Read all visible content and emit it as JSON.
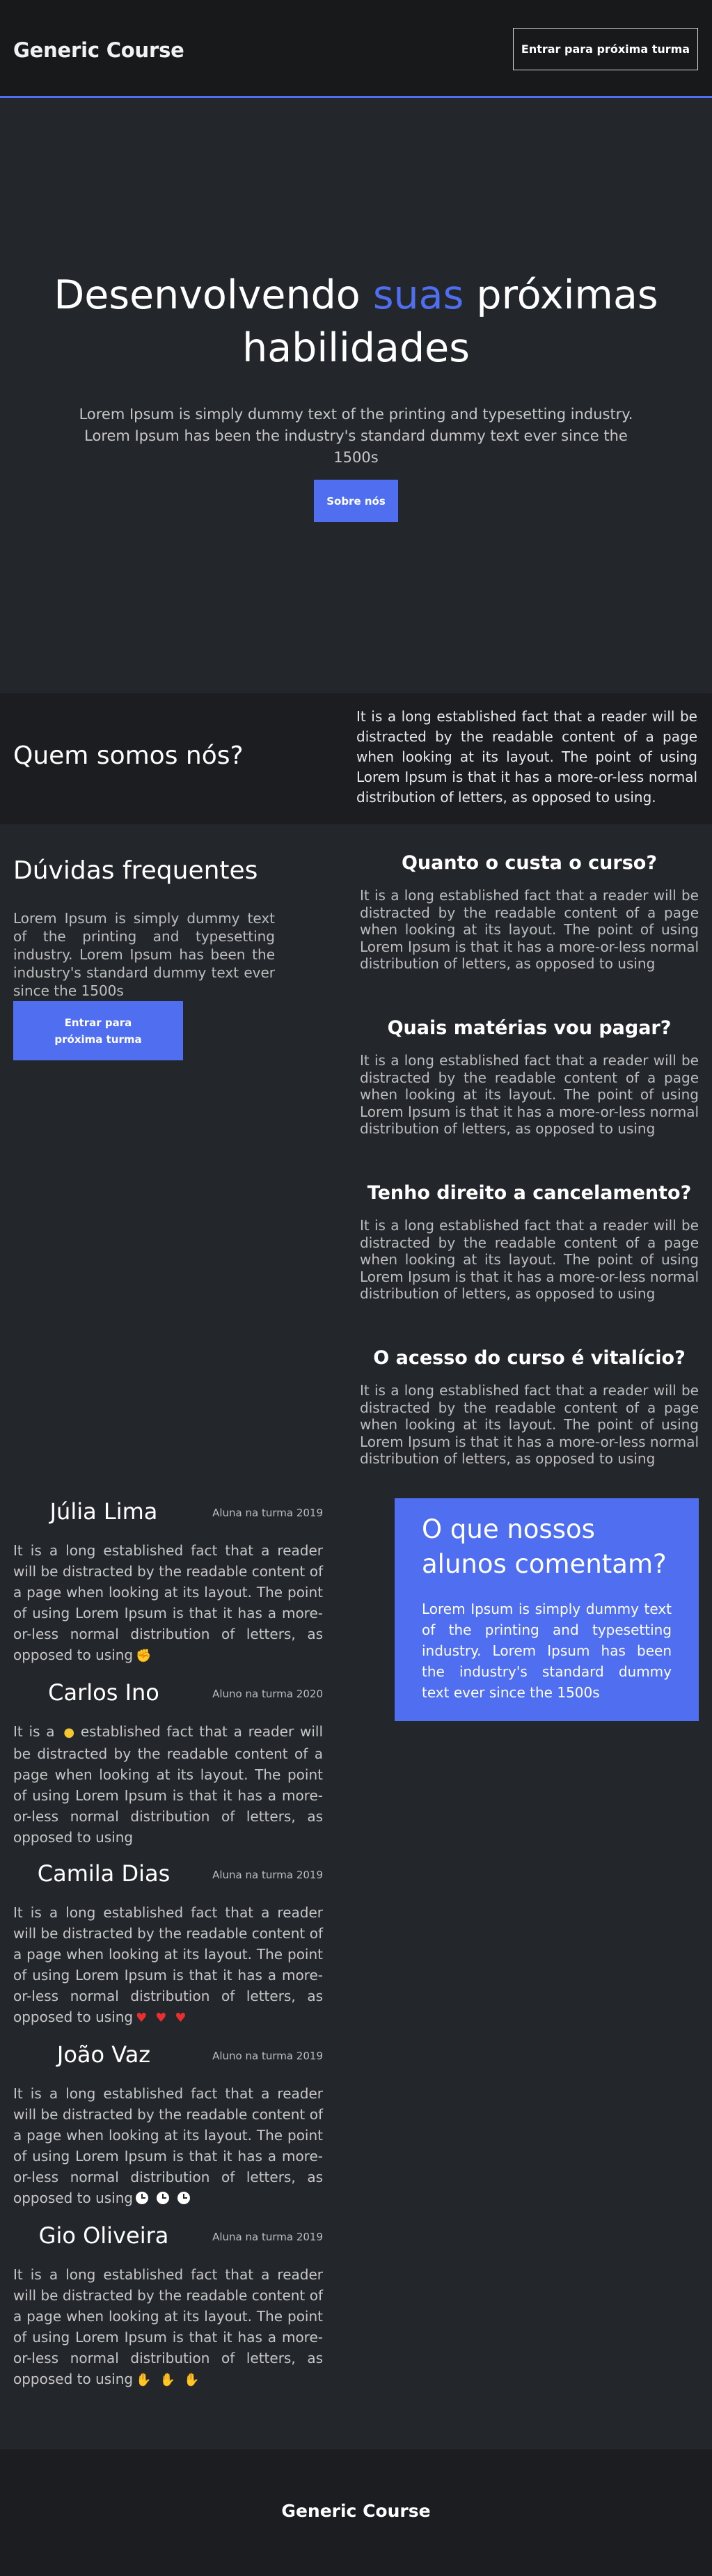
{
  "header": {
    "brand": "Generic Course",
    "cta_label": "Entrar para próxima turma"
  },
  "hero": {
    "title_before": "Desenvolvendo ",
    "title_accent": "suas",
    "title_after": " próximas habilidades",
    "subtitle": "Lorem Ipsum is simply dummy text of the printing and typesetting industry. Lorem Ipsum has been the industry's standard dummy text ever since the 1500s",
    "button_label": "Sobre nós"
  },
  "about": {
    "title": "Quem somos nós?",
    "text": "It is a long established fact that a reader will be distracted by the readable content of a page when looking at its layout. The point of using Lorem Ipsum is that it has a more-or-less normal distribution of letters, as opposed to using."
  },
  "faq": {
    "title": "Dúvidas frequentes",
    "lead": "Lorem Ipsum is simply dummy text of the printing and typesetting industry. Lorem Ipsum has been the industry's standard dummy text ever since the 1500s",
    "button_label": "Entrar para próxima turma",
    "items": [
      {
        "question": "Quanto o custa o curso?",
        "answer": "It is a long established fact that a reader will be distracted by the readable content of a page when looking at its layout. The point of using Lorem Ipsum is that it has a more-or-less normal distribution of letters, as opposed to using"
      },
      {
        "question": "Quais matérias vou pagar?",
        "answer": "It is a long established fact that a reader will be distracted by the readable content of a page when looking at its layout. The point of using Lorem Ipsum is that it has a more-or-less normal distribution of letters, as opposed to using"
      },
      {
        "question": "Tenho direito a cancelamento?",
        "answer": "It is a long established fact that a reader will be distracted by the readable content of a page when looking at its layout. The point of using Lorem Ipsum is that it has a more-or-less normal distribution of letters, as opposed to using"
      },
      {
        "question": "O acesso do curso é vitalício?",
        "answer": "It is a long established fact that a reader will be distracted by the readable content of a page when looking at its layout. The point of using Lorem Ipsum is that it has a more-or-less normal distribution of letters, as opposed to using"
      }
    ]
  },
  "testimonials": {
    "box_title": "O que nossos alunos comentam?",
    "box_text": "Lorem Ipsum is simply dummy text of the printing and typesetting industry. Lorem Ipsum has been the industry's standard dummy text ever since the 1500s",
    "items": [
      {
        "name": "Júlia Lima",
        "turma": "Aluna na turma 2019",
        "text": "It is a long established fact that a reader will be distracted by the readable content of a page when looking at its layout. The point of using Lorem Ipsum is that it has a more-or-less normal distribution of letters, as opposed to using",
        "emoji": "strong-arm-icon"
      },
      {
        "name": "Carlos Ino",
        "turma": "Aluno na turma 2020",
        "text_before": "It is a",
        "text_after": "established fact that a reader will be distracted by the readable content of a page when looking at its layout. The point of using Lorem Ipsum is that it has a more-or-less normal distribution of letters, as opposed to using",
        "emoji": "speech-bubble-icon"
      },
      {
        "name": "Camila Dias",
        "turma": "Aluna na turma 2019",
        "text": "It is a long established fact that a reader will be distracted by the readable content of a page when looking at its layout. The point of using Lorem Ipsum is that it has a more-or-less normal distribution of letters, as opposed to using",
        "emoji": "heart-icon"
      },
      {
        "name": "João Vaz",
        "turma": "Aluno na turma 2019",
        "text": "It is a long established fact that a reader will be distracted by the readable content of a page when looking at its layout. The point of using Lorem Ipsum is that it has a more-or-less normal distribution of letters, as opposed to using",
        "emoji": "clock-icon"
      },
      {
        "name": "Gio Oliveira",
        "turma": "Aluna na turma 2019",
        "text": "It is a long established fact that a reader will be distracted by the readable content of a page when looking at its layout. The point of using Lorem Ipsum is that it has a more-or-less normal distribution of letters, as opposed to using",
        "emoji": "clapping-hands-icon"
      }
    ]
  },
  "footer": {
    "brand": "Generic Course"
  },
  "colors": {
    "accent": "#4f6ff0",
    "background": "#23262a",
    "header_background": "#17191b"
  }
}
